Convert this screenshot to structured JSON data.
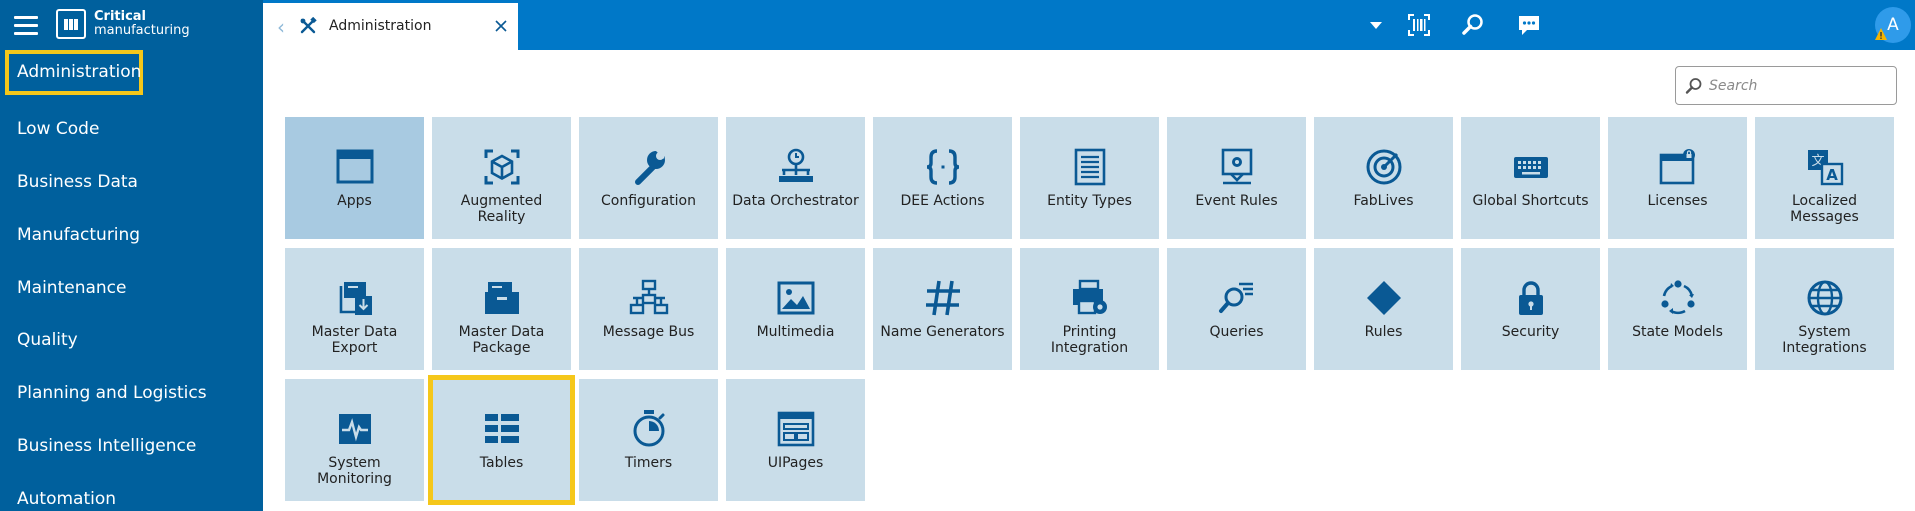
{
  "brand": {
    "line1": "Critical",
    "line2": "manufacturing"
  },
  "sidebar": {
    "items": [
      {
        "label": "Administration"
      },
      {
        "label": "Low Code"
      },
      {
        "label": "Business Data"
      },
      {
        "label": "Manufacturing"
      },
      {
        "label": "Maintenance"
      },
      {
        "label": "Quality"
      },
      {
        "label": "Planning and Logistics"
      },
      {
        "label": "Business Intelligence"
      },
      {
        "label": "Automation"
      }
    ]
  },
  "tab": {
    "label": "Administration"
  },
  "user": {
    "initial": "A"
  },
  "search": {
    "placeholder": "Search",
    "value": ""
  },
  "colors": {
    "sidebar": "#00609d",
    "topbar": "#0078c8",
    "tile": "#c9dde9",
    "tile_selected": "#a8cae1",
    "icon": "#0a5994",
    "highlight": "#f5c71a"
  },
  "tiles": [
    {
      "label": "Apps",
      "icon": "apps-icon"
    },
    {
      "label": "Augmented Reality",
      "icon": "augmented-reality-icon"
    },
    {
      "label": "Configuration",
      "icon": "wrench-icon"
    },
    {
      "label": "Data Orchestrator",
      "icon": "data-orchestrator-icon"
    },
    {
      "label": "DEE Actions",
      "icon": "curly-braces-icon"
    },
    {
      "label": "Entity Types",
      "icon": "document-list-icon"
    },
    {
      "label": "Event Rules",
      "icon": "event-rules-icon"
    },
    {
      "label": "FabLives",
      "icon": "target-icon"
    },
    {
      "label": "Global Shortcuts",
      "icon": "keyboard-icon"
    },
    {
      "label": "Licenses",
      "icon": "license-window-icon"
    },
    {
      "label": "Localized Messages",
      "icon": "translate-icon"
    },
    {
      "label": "Master Data Export",
      "icon": "export-package-icon"
    },
    {
      "label": "Master Data Package",
      "icon": "package-icon"
    },
    {
      "label": "Message Bus",
      "icon": "network-icon"
    },
    {
      "label": "Multimedia",
      "icon": "image-icon"
    },
    {
      "label": "Name Generators",
      "icon": "hash-icon"
    },
    {
      "label": "Printing Integration",
      "icon": "printer-gear-icon"
    },
    {
      "label": "Queries",
      "icon": "search-list-icon"
    },
    {
      "label": "Rules",
      "icon": "diamond-icon"
    },
    {
      "label": "Security",
      "icon": "lock-icon"
    },
    {
      "label": "State Models",
      "icon": "cycle-icon"
    },
    {
      "label": "System Integrations",
      "icon": "globe-icon"
    },
    {
      "label": "System Monitoring",
      "icon": "pulse-monitor-icon"
    },
    {
      "label": "Tables",
      "icon": "table-icon"
    },
    {
      "label": "Timers",
      "icon": "stopwatch-icon"
    },
    {
      "label": "UIPages",
      "icon": "layout-icon"
    }
  ]
}
